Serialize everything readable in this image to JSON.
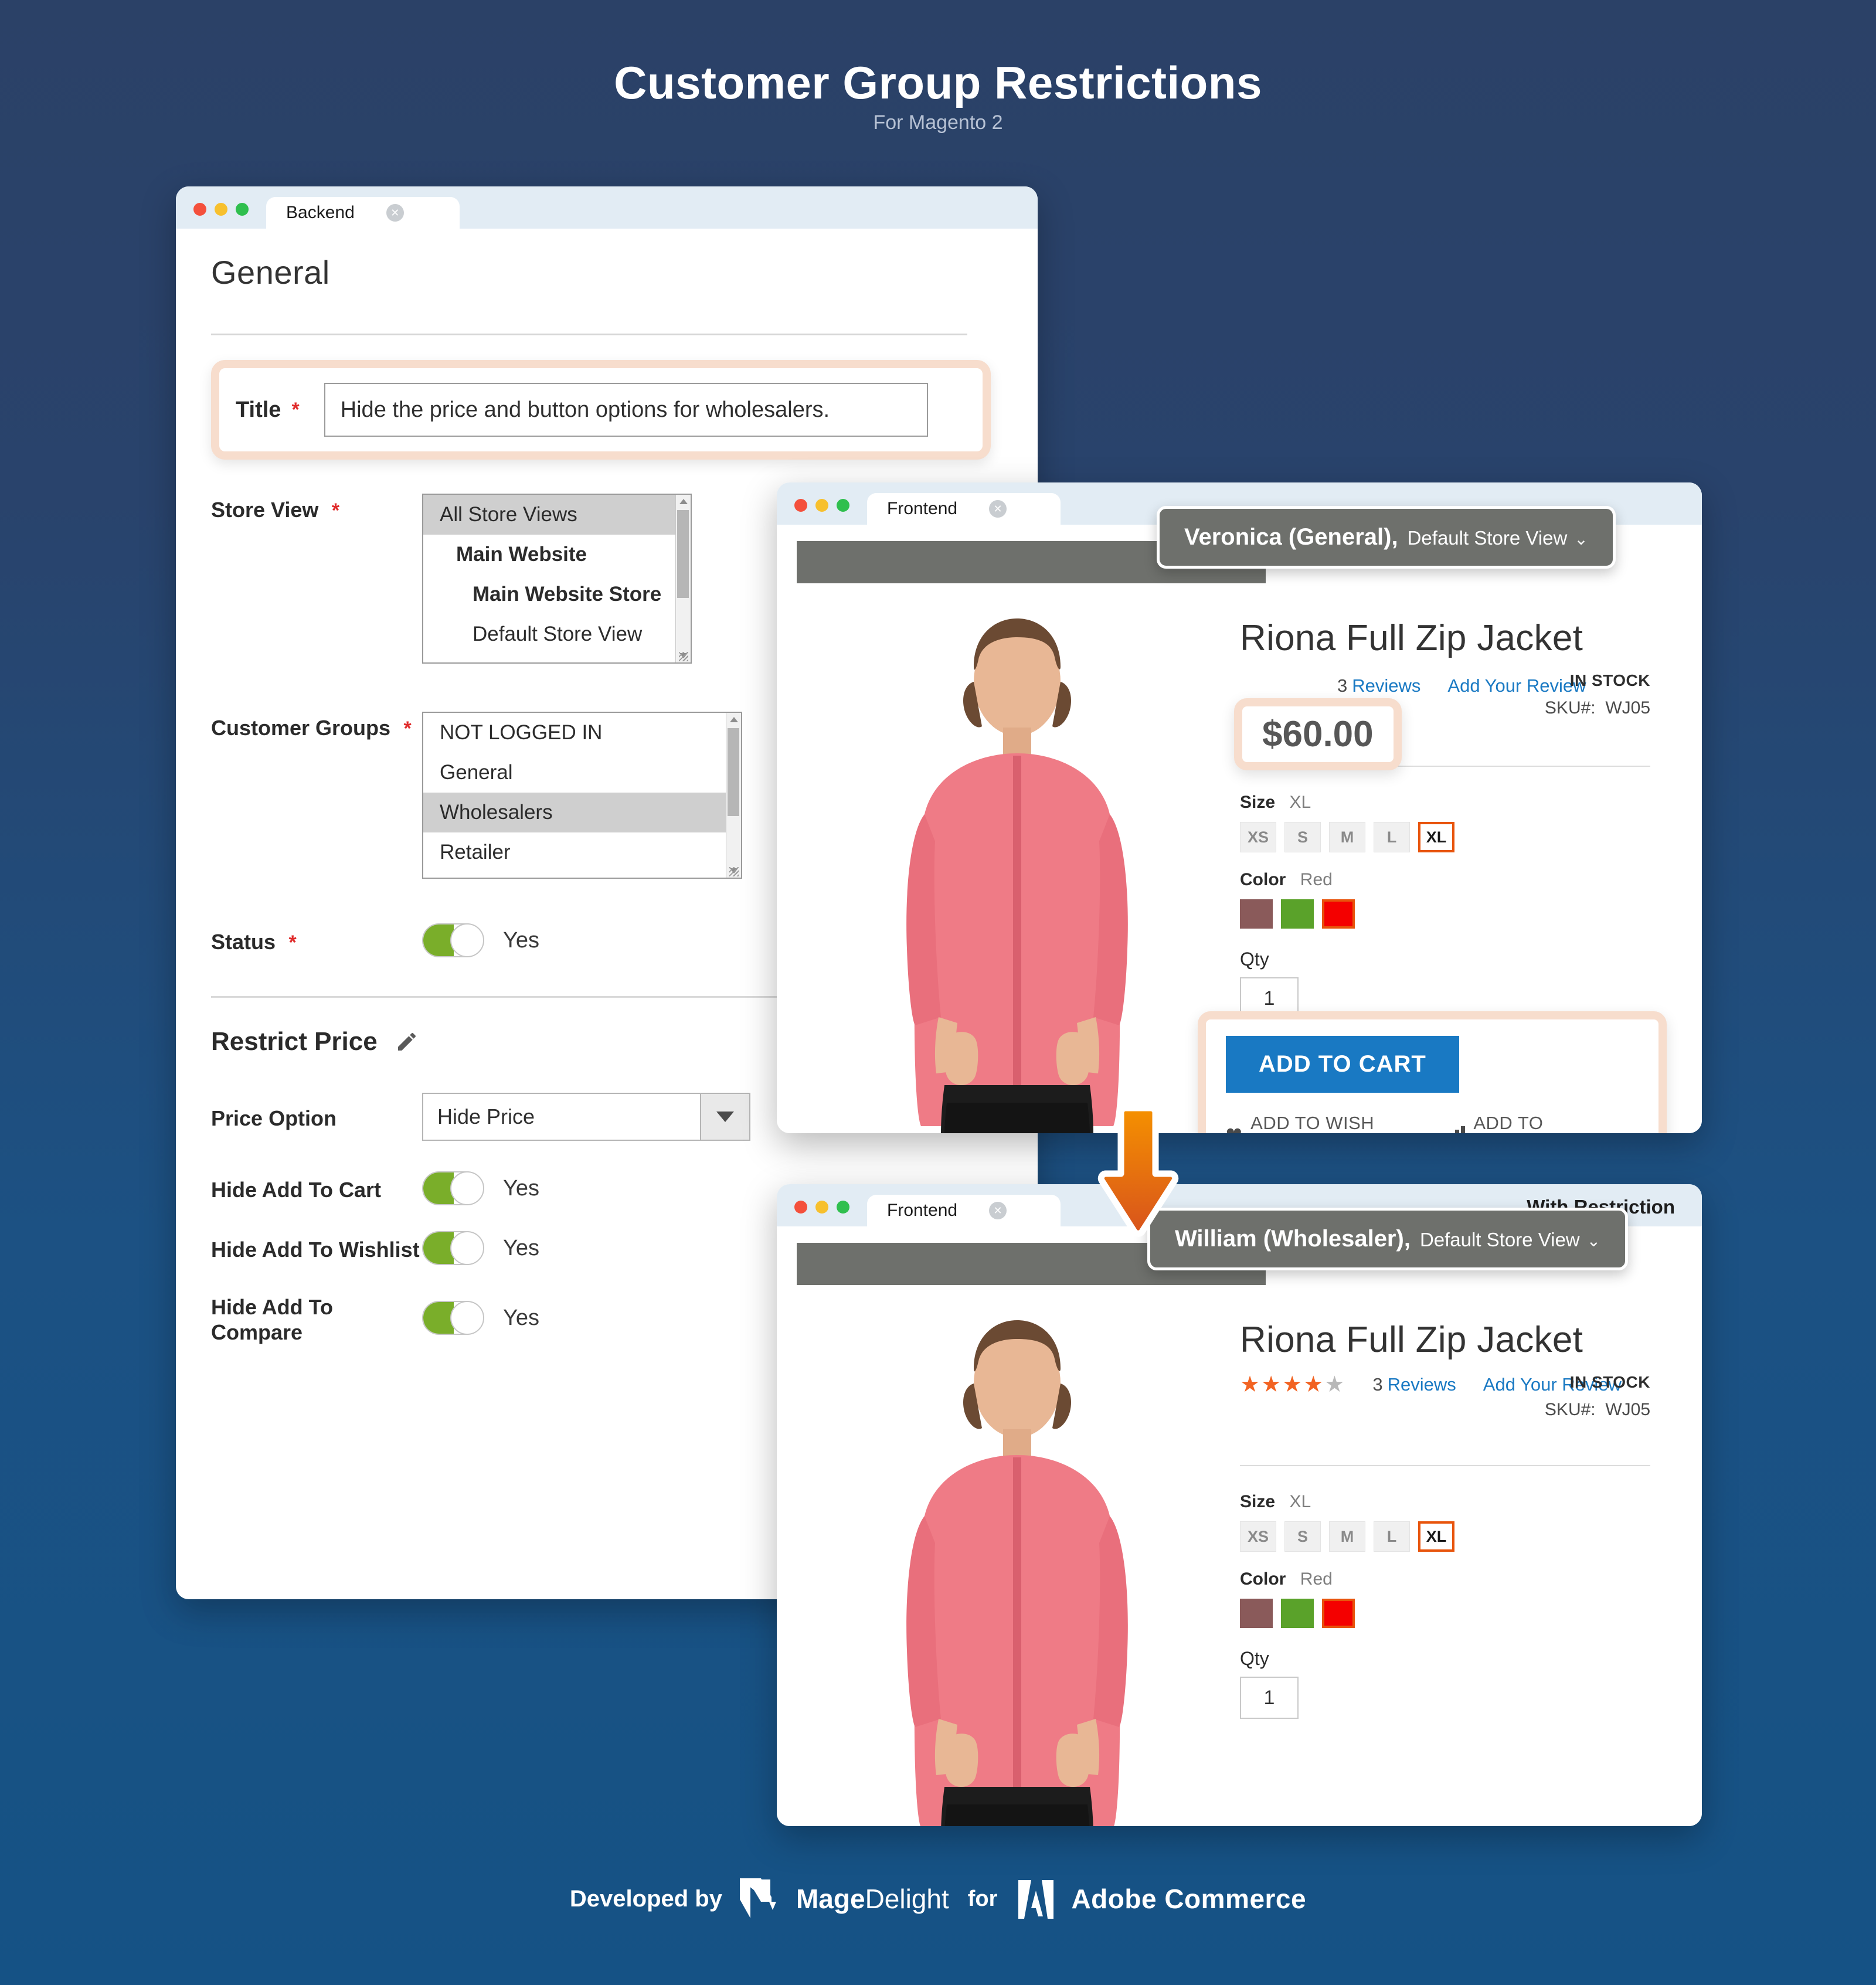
{
  "hero": {
    "title": "Customer Group Restrictions",
    "subtitle": "For Magento 2"
  },
  "colors": {
    "bg_top": "#2b4167",
    "bg_bottom": "#155285",
    "accent_orange": "#e8540c",
    "accent_blue": "#1979c3",
    "toggle_green": "#7aae2a",
    "highlight_peach": "#f7ddcd"
  },
  "backend": {
    "tab_label": "Backend",
    "close_icon": "close-icon",
    "page_title": "General",
    "title_field": {
      "label": "Title",
      "required": "*",
      "value": "Hide the price and button options for wholesalers."
    },
    "store_view": {
      "label": "Store View",
      "required": "*",
      "options": [
        {
          "text": "All Store Views",
          "indent": 0,
          "bold": false,
          "selected": true
        },
        {
          "text": "Main Website",
          "indent": 1,
          "bold": true,
          "selected": false
        },
        {
          "text": "Main Website Store",
          "indent": 2,
          "bold": true,
          "selected": false
        },
        {
          "text": "Default Store View",
          "indent": 3,
          "bold": false,
          "selected": false
        }
      ]
    },
    "customer_groups": {
      "label": "Customer Groups",
      "required": "*",
      "options": [
        {
          "text": "NOT LOGGED IN",
          "selected": false
        },
        {
          "text": "General",
          "selected": false
        },
        {
          "text": "Wholesalers",
          "selected": true
        },
        {
          "text": "Retailer",
          "selected": false
        }
      ]
    },
    "status": {
      "label": "Status",
      "required": "*",
      "value": "Yes"
    },
    "restrict_price": {
      "heading": "Restrict Price",
      "edit_icon": "pencil-icon",
      "price_option": {
        "label": "Price Option",
        "value": "Hide Price",
        "caret": "chevron-down-icon"
      },
      "hide_add_to_cart": {
        "label": "Hide Add To Cart",
        "value": "Yes"
      },
      "hide_add_to_wishlist": {
        "label": "Hide Add To Wishlist",
        "value": "Yes"
      },
      "hide_add_to_compare": {
        "label": "Hide Add To Compare",
        "value": "Yes"
      }
    }
  },
  "frontend_top": {
    "tab_label": "Frontend",
    "close_icon": "close-icon",
    "user_pill": {
      "name": "Veronica (General),",
      "store_view": "Default Store View",
      "caret": "chevron-down-icon"
    },
    "product": {
      "name": "Riona Full Zip Jacket",
      "reviews_count": "3",
      "reviews_label": "Reviews",
      "add_review": "Add Your Review",
      "stock": "IN STOCK",
      "sku_label": "SKU#:",
      "sku": "WJ05",
      "price": "$60.00",
      "size_label": "Size",
      "size_value": "XL",
      "sizes": [
        "XS",
        "S",
        "M",
        "L",
        "XL"
      ],
      "size_selected": "XL",
      "color_label": "Color",
      "color_value": "Red",
      "colors": [
        "#8a5a5a",
        "#5aa22a",
        "#f40000"
      ],
      "color_selected_index": 2,
      "qty_label": "Qty",
      "qty_value": "1",
      "add_to_cart": "ADD TO CART",
      "add_to_wishlist": "ADD TO WISH LIST",
      "add_to_compare": "ADD TO COMPARE",
      "wishlist_icon": "heart-icon",
      "compare_icon": "bar-chart-icon"
    }
  },
  "frontend_bottom": {
    "tab_label": "Frontend",
    "close_icon": "close-icon",
    "badge": "With Restriction",
    "user_pill": {
      "name": "William (Wholesaler),",
      "store_view": "Default Store View",
      "caret": "chevron-down-icon"
    },
    "product": {
      "name": "Riona Full Zip Jacket",
      "rating_stars": 4.5,
      "reviews_count": "3",
      "reviews_label": "Reviews",
      "add_review": "Add Your Review",
      "stock": "IN STOCK",
      "sku_label": "SKU#:",
      "sku": "WJ05",
      "size_label": "Size",
      "size_value": "XL",
      "sizes": [
        "XS",
        "S",
        "M",
        "L",
        "XL"
      ],
      "size_selected": "XL",
      "color_label": "Color",
      "color_value": "Red",
      "colors": [
        "#8a5a5a",
        "#5aa22a",
        "#f40000"
      ],
      "color_selected_index": 2,
      "qty_label": "Qty",
      "qty_value": "1"
    }
  },
  "arrow": {
    "icon": "arrow-down-icon"
  },
  "footer": {
    "developed_by": "Developed by",
    "magedelight_mage": "Mage",
    "magedelight_delight": "Delight",
    "for": "for",
    "adobe": "Adobe Commerce",
    "md_logo_icon": "magedelight-logo-icon",
    "adobe_logo_icon": "adobe-logo-icon"
  }
}
